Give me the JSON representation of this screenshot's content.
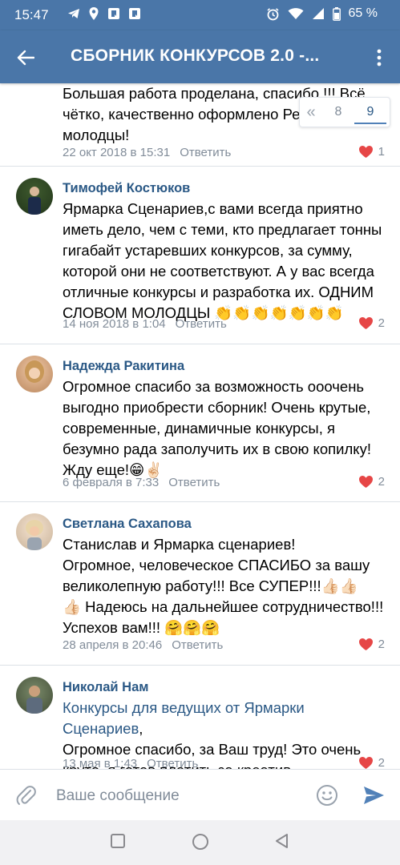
{
  "status": {
    "time": "15:47",
    "battery": "65 %"
  },
  "header": {
    "title": "СБОРНИК КОНКУРСОВ 2.0 -..."
  },
  "pager": {
    "prev": "«",
    "pages": [
      "8",
      "9"
    ],
    "active": "9"
  },
  "comments": [
    {
      "author": "",
      "lines": [
        "Большая работа проделана, спасибо !!! Всё",
        "чётко, качественно оформлено Рес",
        "молодцы!"
      ],
      "date": "22 окт 2018 в 15:31",
      "reply": "Ответить",
      "likes": "1"
    },
    {
      "author": "Тимофей Костюков",
      "lines": [
        "Ярмарка Сценариев,с вами всегда приятно",
        "иметь дело, чем с теми, кто предлагает тонны",
        "гигабайт устаревших конкурсов, за сумму,",
        "которой они не соответствуют. А  у вас всегда",
        "отличные конкурсы и разработка их. ОДНИМ",
        "СЛОВОМ МОЛОДЦЫ 👏👏👏👏👏👏👏"
      ],
      "date": "14 ноя 2018 в 1:04",
      "reply": "Ответить",
      "likes": "2"
    },
    {
      "author": "Надежда Ракитина",
      "lines": [
        "Огромное спасибо за возможность ооочень",
        "выгодно приобрести сборник! Очень крутые,",
        "современные, динамичные конкурсы, я",
        "безумно рада заполучить их в свою копилку!",
        "Жду еще!😁✌🏻"
      ],
      "date": "6 февраля в 7:33",
      "reply": "Ответить",
      "likes": "2"
    },
    {
      "author": "Светлана Сахапова",
      "lines": [
        "Станислав и Ярмарка сценариев!",
        "Огромное, человеческое СПАСИБО за вашу",
        "великолепную работу!!! Все СУПЕР!!!👍🏻👍🏻",
        "👍🏻 Надеюсь на дальнейшее сотрудничество!!!",
        "Успехов вам!!! 🤗🤗🤗"
      ],
      "date": "28 апреля в 20:46",
      "reply": "Ответить",
      "likes": "2"
    },
    {
      "author": "Николай Нам",
      "link": "Конкурсы для ведущих от Ярмарки Сценариев",
      "lines": [
        ",",
        "Огромное спасибо, за Ваш труд! Это очень",
        "круто, я готов платить за креатив."
      ],
      "date": "13 мая в 1:43",
      "reply": "Ответить",
      "likes": "2"
    }
  ],
  "composer": {
    "placeholder": "Ваше сообщение"
  },
  "colors": {
    "primary": "#4a76a8",
    "link": "#2a5885",
    "meta": "#818c99",
    "like": "#e64646",
    "send": "#5181b8"
  },
  "icons": [
    "back-arrow-icon",
    "more-vert-icon",
    "heart-icon",
    "attach-icon",
    "smile-icon",
    "send-icon",
    "nav-square-icon",
    "nav-circle-icon",
    "nav-back-icon"
  ]
}
